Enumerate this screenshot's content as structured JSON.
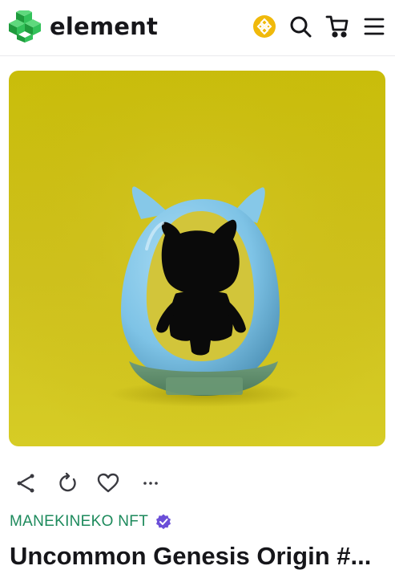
{
  "header": {
    "brand": "element",
    "icons": [
      "element-logo-icon",
      "bnb-chain-icon",
      "search-icon",
      "cart-icon",
      "menu-icon"
    ],
    "colors": {
      "logo_green": "#2fb24c",
      "bnb_gold": "#f0b90b"
    }
  },
  "nft": {
    "image_alt": "Manekineko egg capsule with silhouette figure on yellow background",
    "colors": {
      "background": "#cfc11e",
      "capsule": "#7ec3e6",
      "base": "#5e8f6d",
      "silhouette": "#0a0a0a"
    }
  },
  "actions": {
    "icons": [
      "share-icon",
      "refresh-icon",
      "heart-icon",
      "more-icon"
    ]
  },
  "collection": {
    "name": "MANEKINEKO NFT",
    "verified": true,
    "color": "#1d8a5c"
  },
  "item": {
    "title": "Uncommon Genesis Origin #..."
  }
}
